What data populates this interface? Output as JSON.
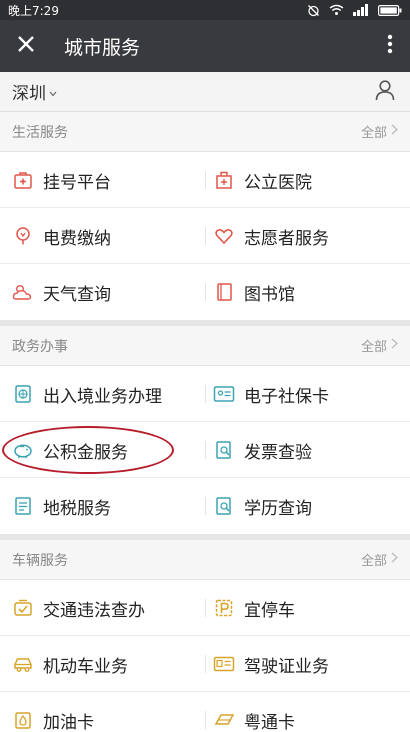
{
  "status_bar": {
    "time": "晚上7:29"
  },
  "title_bar": {
    "title": "城市服务"
  },
  "city_bar": {
    "city": "深圳"
  },
  "colors": {
    "accent_red": "#e2574c",
    "accent_orange": "#f0a04b",
    "accent_teal": "#3aa3b3",
    "accent_yellow": "#d9a32a",
    "title_bg": "#393a3f",
    "highlight_ellipse": "#b51d2b"
  },
  "sections": [
    {
      "title": "生活服务",
      "all_label": "全部",
      "items": [
        {
          "label": "挂号平台",
          "icon": "hospital-registration-icon"
        },
        {
          "label": "公立医院",
          "icon": "hospital-building-icon"
        },
        {
          "label": "电费缴纳",
          "icon": "lightbulb-icon"
        },
        {
          "label": "志愿者服务",
          "icon": "heart-icon"
        },
        {
          "label": "天气查询",
          "icon": "weather-cloud-icon"
        },
        {
          "label": "图书馆",
          "icon": "book-icon"
        }
      ]
    },
    {
      "title": "政务办事",
      "all_label": "全部",
      "items": [
        {
          "label": "出入境业务办理",
          "icon": "passport-globe-icon"
        },
        {
          "label": "电子社保卡",
          "icon": "id-card-icon"
        },
        {
          "label": "公积金服务",
          "icon": "piggy-bank-icon"
        },
        {
          "label": "发票查验",
          "icon": "invoice-search-icon"
        },
        {
          "label": "地税服务",
          "icon": "tax-document-icon"
        },
        {
          "label": "学历查询",
          "icon": "education-search-icon"
        }
      ]
    },
    {
      "title": "车辆服务",
      "all_label": "全部",
      "items": [
        {
          "label": "交通违法查办",
          "icon": "traffic-violation-icon"
        },
        {
          "label": "宜停车",
          "icon": "parking-icon"
        },
        {
          "label": "机动车业务",
          "icon": "car-icon"
        },
        {
          "label": "驾驶证业务",
          "icon": "driver-license-icon"
        },
        {
          "label": "加油卡",
          "icon": "fuel-card-icon"
        },
        {
          "label": "粤通卡",
          "icon": "toll-card-icon"
        }
      ]
    }
  ]
}
